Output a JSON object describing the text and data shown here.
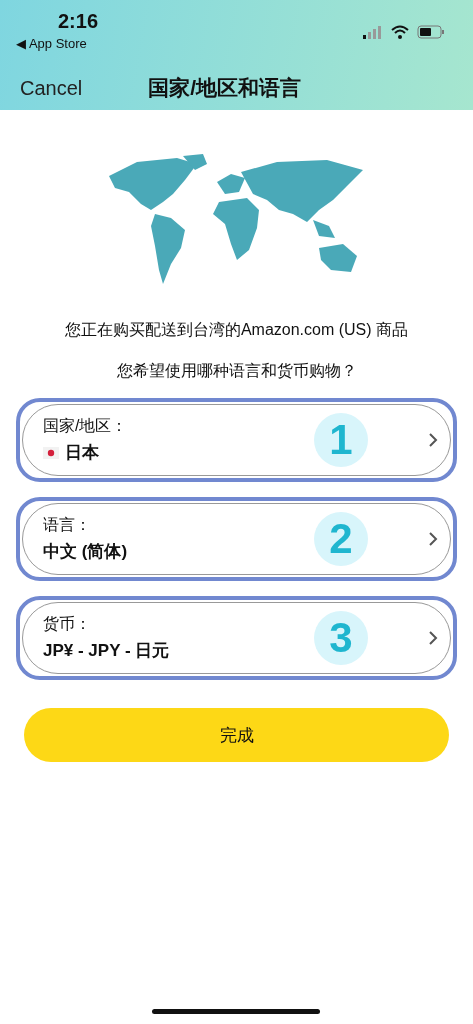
{
  "status_bar": {
    "time": "2:16",
    "back_label": "◀ App Store"
  },
  "nav": {
    "cancel": "Cancel",
    "title": "国家/地区和语言"
  },
  "intro": [
    "您正在购买配送到台湾的Amazon.com (US) 商品",
    "您希望使用哪种语言和货币购物？"
  ],
  "settings": [
    {
      "kind": "flag",
      "label": "国家/地区：",
      "value": "日本",
      "marker": "1"
    },
    {
      "kind": "plain",
      "label": "语言：",
      "value": "中文 (简体)",
      "marker": "2"
    },
    {
      "kind": "plain",
      "label": "货币：",
      "value": "JP¥ - JPY - 日元",
      "marker": "3"
    }
  ],
  "done_button": "完成"
}
